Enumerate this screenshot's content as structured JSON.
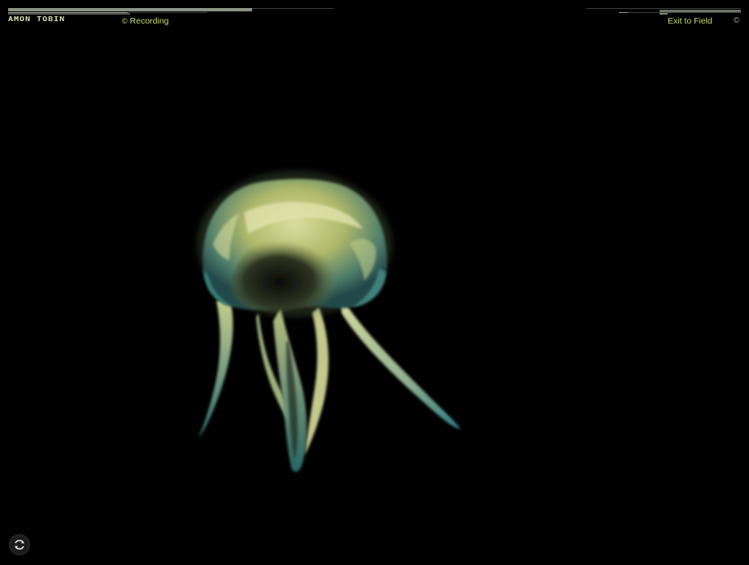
{
  "header": {
    "logo_text": "AMON TOBIN",
    "recording_label": "Recording",
    "exit_label": "Exit to Field",
    "copyright_glyph": "©"
  },
  "progress": {
    "left_top_fraction": 0.75,
    "left_bottom_fraction": 0.6,
    "right_top_fraction": 0.0,
    "right_bottom_fraction": 0.07
  },
  "icons": {
    "recording": "copyright-circle-icon",
    "exit": "exit-icon",
    "corner": "copyright-circle-icon",
    "reload": "reload-icon"
  },
  "colors": {
    "background": "#000000",
    "accent": "#c9d86c",
    "creature_glow": "#cfd893",
    "creature_teal": "#3f8f86"
  }
}
